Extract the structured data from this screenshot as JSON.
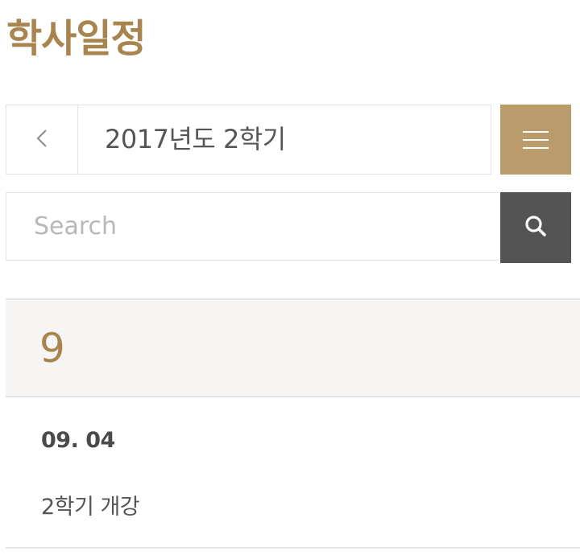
{
  "header": {
    "title": "학사일정"
  },
  "semester_selector": {
    "prev_icon": "chevron-left-icon",
    "current": "2017년도 2학기",
    "menu_icon": "hamburger-menu-icon"
  },
  "search": {
    "placeholder": "Search",
    "value": "",
    "icon": "search-icon"
  },
  "calendar": {
    "month": "9",
    "events": [
      {
        "date": "09. 04",
        "title": "2학기 개강"
      }
    ]
  },
  "colors": {
    "accent": "#a8844e",
    "menu_button_bg": "#b99b6c",
    "search_button_bg": "#545454",
    "month_header_bg": "#f6f5f3",
    "border": "#e3e3e3"
  }
}
